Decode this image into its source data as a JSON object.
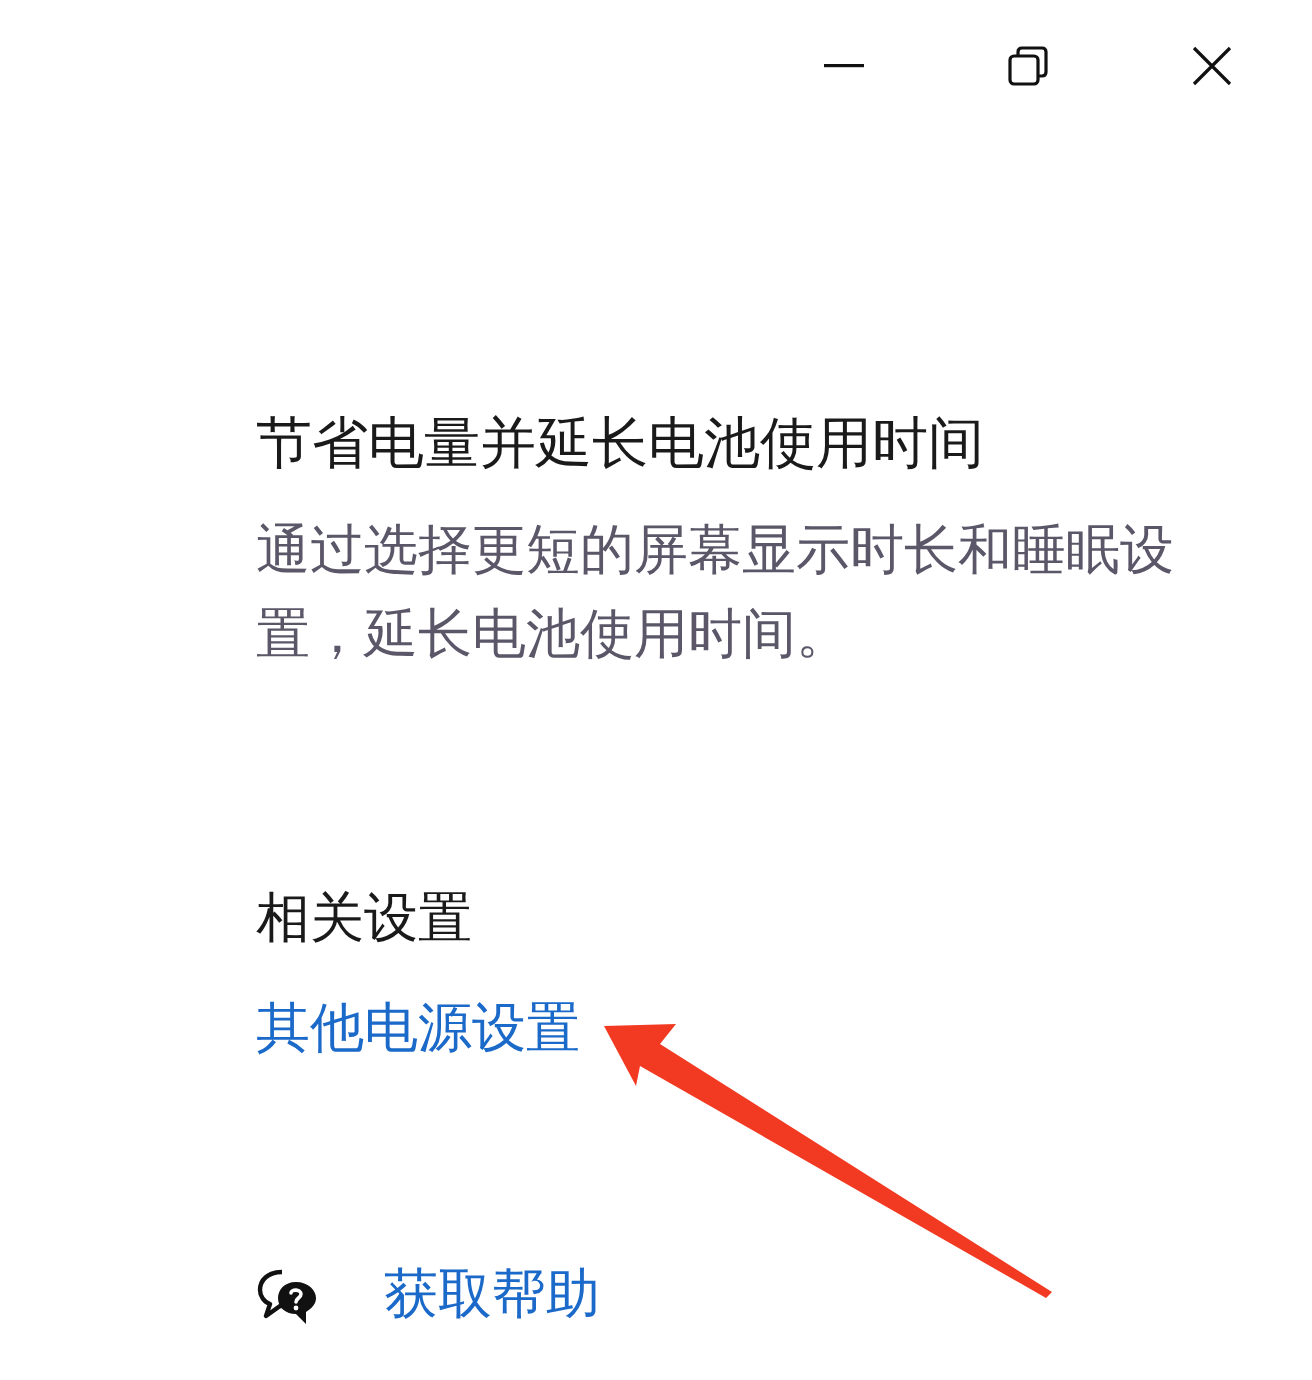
{
  "window": {
    "controls": [
      {
        "kind": "minimize"
      },
      {
        "kind": "restore"
      },
      {
        "kind": "close"
      }
    ]
  },
  "section": {
    "title": "节省电量并延长电池使用时间",
    "description": "通过选择更短的屏幕显示时长和睡眠设置，延长电池使用时间。"
  },
  "related_settings": {
    "heading": "相关设置",
    "links": [
      "其他电源设置"
    ]
  },
  "help": {
    "label": "获取帮助"
  }
}
